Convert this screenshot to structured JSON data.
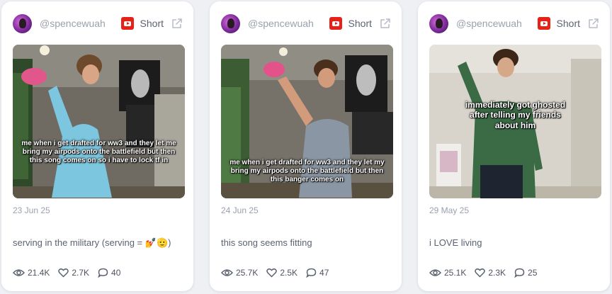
{
  "cards": [
    {
      "handle": "@spencewuah",
      "platform": "Short",
      "caption": "me when i get drafted for ww3 and they let me bring my airpods onto the battlefield but then this song comes on so i have to lock tf in",
      "date": "23 Jun 25",
      "title": "serving in the military (serving = 💅🫡)",
      "views": "21.4K",
      "likes": "2.7K",
      "comments": "40"
    },
    {
      "handle": "@spencewuah",
      "platform": "Short",
      "caption": "me when i get drafted for ww3 and they let my bring my airpods onto the battlefield but then this banger comes on",
      "date": "24 Jun 25",
      "title": "this song seems fitting",
      "views": "25.7K",
      "likes": "2.5K",
      "comments": "47"
    },
    {
      "handle": "@spencewuah",
      "platform": "Short",
      "caption": "immediately got ghosted after telling my friends about him",
      "date": "29 May 25",
      "title": "i LOVE living",
      "views": "25.1K",
      "likes": "2.3K",
      "comments": "25"
    }
  ],
  "icons": {
    "platform": "youtube-icon",
    "external": "external-link-icon",
    "views": "eye-icon",
    "likes": "heart-icon",
    "comments": "comment-icon"
  },
  "colors": {
    "youtube_red": "#e62117",
    "muted_text": "#9aa1ad",
    "body_text": "#5b6270",
    "page_bg": "#eef0f4"
  }
}
